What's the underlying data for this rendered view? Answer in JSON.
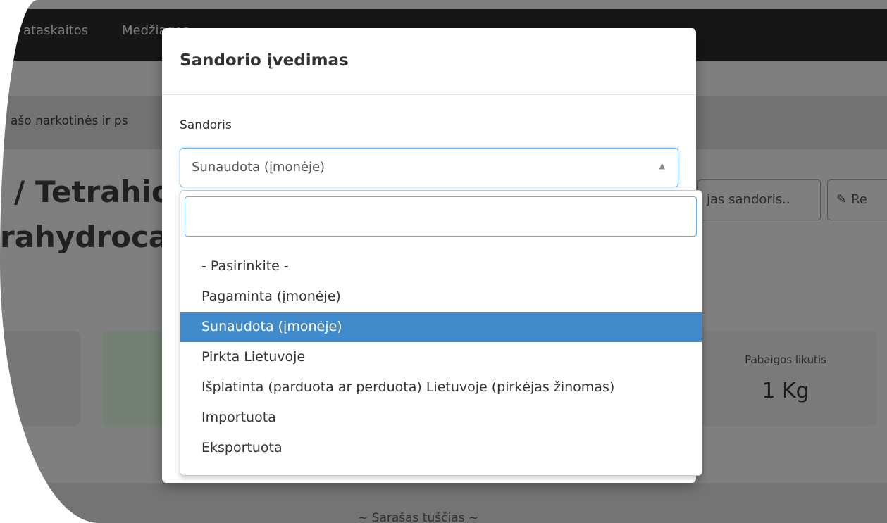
{
  "background": {
    "nav": {
      "link_reports": "ataskaitos",
      "link_materials": "Medžiagos"
    },
    "breadcrumb": "ašo narkotinės ir ps",
    "title_line1": "/ Tetrahic",
    "title_line2": "rahydroca",
    "button_new_transaction": "jas sandoris..",
    "button_edit": "Re",
    "end_balance_card": {
      "label": "Pabaigos likutis",
      "value": "1 Kg"
    },
    "empty_list_text": "~ Sarašas tuščias ~"
  },
  "modal": {
    "title": "Sandorio įvedimas",
    "field_label": "Sandoris",
    "selected_value": "Sunaudota (įmonėje)",
    "search": {
      "value": "",
      "placeholder": ""
    },
    "options": [
      {
        "label": "- Pasirinkite -",
        "selected": false
      },
      {
        "label": "Pagaminta (įmonėje)",
        "selected": false
      },
      {
        "label": "Sunaudota (įmonėje)",
        "selected": true
      },
      {
        "label": "Pirkta Lietuvoje",
        "selected": false
      },
      {
        "label": "Išplatinta (parduota ar perduota) Lietuvoje (pirkėjas žinomas)",
        "selected": false
      },
      {
        "label": "Importuota",
        "selected": false
      },
      {
        "label": "Eksportuota",
        "selected": false
      }
    ]
  },
  "colors": {
    "highlight": "#428bca",
    "focus_border": "#66afe9",
    "overlay": "#7f7f7f",
    "navbar": "#161616"
  },
  "icons": {
    "select_arrow": "caret-up-icon",
    "edit": "pencil-icon",
    "menu_dropdown": "caret-down-icon"
  }
}
